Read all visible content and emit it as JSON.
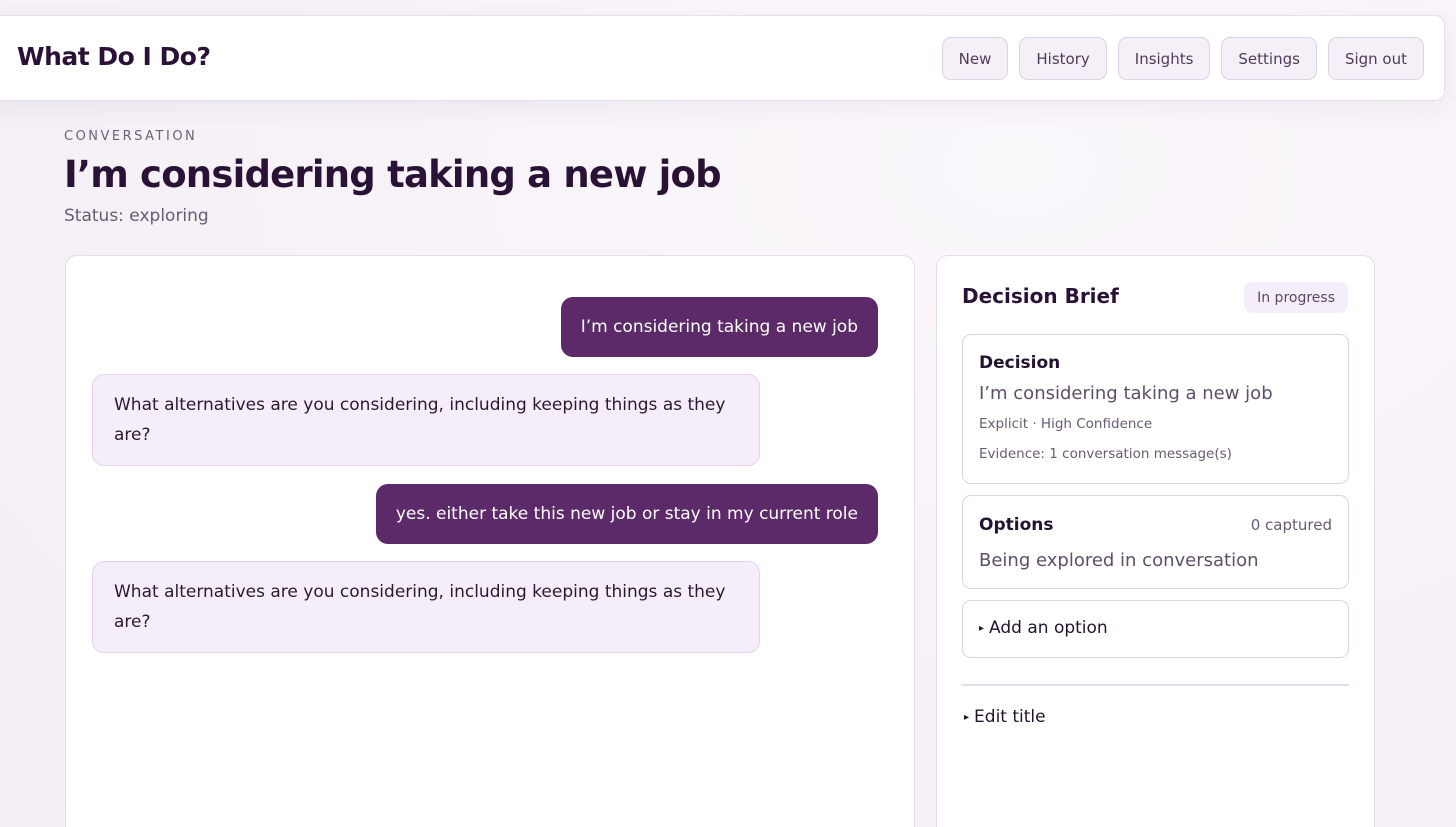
{
  "app": {
    "title": "What Do I Do?"
  },
  "nav": {
    "new": "New",
    "history": "History",
    "insights": "Insights",
    "settings": "Settings",
    "sign_out": "Sign out"
  },
  "header": {
    "eyebrow": "CONVERSATION",
    "title": "I’m considering taking a new job",
    "status": "Status: exploring"
  },
  "messages": [
    {
      "role": "user",
      "text": "I’m considering taking a new job"
    },
    {
      "role": "assistant",
      "text": "What alternatives are you considering, including keeping things as they are?"
    },
    {
      "role": "user",
      "text": "yes. either take this new job or stay in my current role"
    },
    {
      "role": "assistant",
      "text": "What alternatives are you considering, including keeping things as they are?"
    }
  ],
  "brief": {
    "title": "Decision Brief",
    "badge": "In progress",
    "decision": {
      "label": "Decision",
      "value": "I’m considering taking a new job",
      "meta": "Explicit · High Confidence",
      "evidence": "Evidence: 1 conversation message(s)"
    },
    "options": {
      "label": "Options",
      "count": "0 captured",
      "value": "Being explored in conversation"
    },
    "add_option": "Add an option",
    "edit_title": "Edit title"
  },
  "icons": {
    "disclosure": "triangle-right-icon"
  },
  "colors": {
    "accent": "#5c2a68",
    "assistant_bubble": "#f5eefa",
    "text_dark": "#2a1236"
  }
}
